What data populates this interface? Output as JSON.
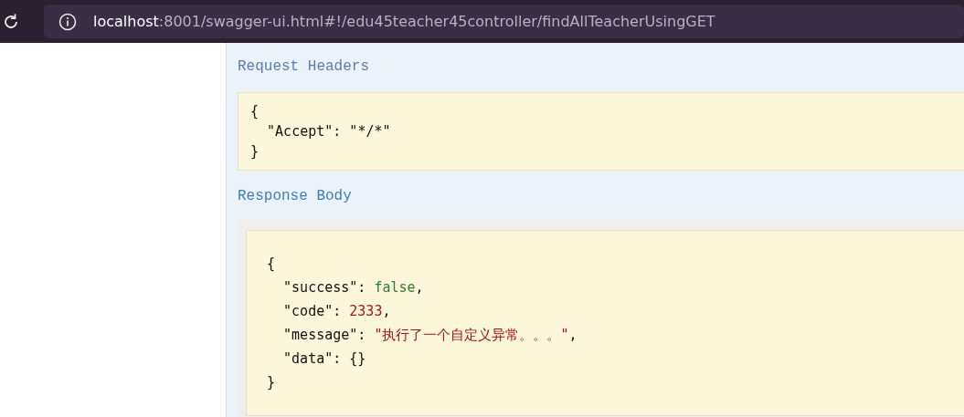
{
  "browser": {
    "url_host": "localhost",
    "url_rest": ":8001/swagger-ui.html#!/edu45teacher45controller/findAllTeacherUsingGET"
  },
  "request_headers": {
    "title": "Request Headers",
    "lines": [
      [
        {
          "text": "{",
          "kind": "plain"
        }
      ],
      [
        {
          "text": "  \"Accept\": \"*/*\"",
          "kind": "plain"
        }
      ],
      [
        {
          "text": "}",
          "kind": "plain"
        }
      ]
    ]
  },
  "response_body": {
    "title": "Response Body",
    "lines": [
      [
        {
          "text": "{",
          "kind": "plain"
        }
      ],
      [
        {
          "text": "  \"success\": ",
          "kind": "plain"
        },
        {
          "text": "false",
          "kind": "boolean"
        },
        {
          "text": ",",
          "kind": "plain"
        }
      ],
      [
        {
          "text": "  \"code\": ",
          "kind": "plain"
        },
        {
          "text": "2333",
          "kind": "number"
        },
        {
          "text": ",",
          "kind": "plain"
        }
      ],
      [
        {
          "text": "  \"message\": ",
          "kind": "plain"
        },
        {
          "text": "\"执行了一个自定义异常。。。\"",
          "kind": "string"
        },
        {
          "text": ",",
          "kind": "plain"
        }
      ],
      [
        {
          "text": "  \"data\": {}",
          "kind": "plain"
        }
      ],
      [
        {
          "text": "}",
          "kind": "plain"
        }
      ]
    ]
  }
}
